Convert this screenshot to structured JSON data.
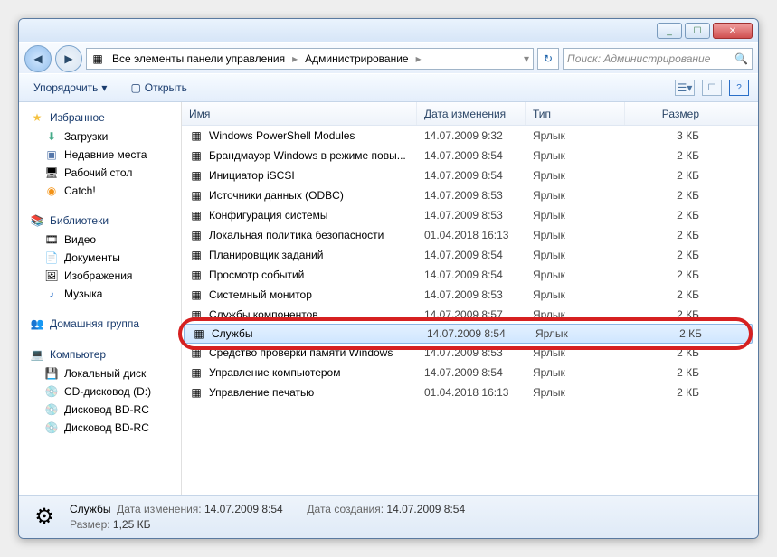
{
  "titlebar": {
    "min": "_",
    "max": "☐",
    "close": "✕"
  },
  "nav": {
    "crumb1": "Все элементы панели управления",
    "crumb2": "Администрирование",
    "search_placeholder": "Поиск: Администрирование"
  },
  "toolbar": {
    "organize": "Упорядочить",
    "open": "Открыть"
  },
  "sidebar": {
    "favorites": "Избранное",
    "fav_items": [
      "Загрузки",
      "Недавние места",
      "Рабочий стол",
      "Catch!"
    ],
    "libs": "Библиотеки",
    "lib_items": [
      "Видео",
      "Документы",
      "Изображения",
      "Музыка"
    ],
    "homegroup": "Домашняя группа",
    "computer": "Компьютер",
    "comp_items": [
      "Локальный диск",
      "CD-дисковод (D:)",
      "Дисковод BD-RС",
      "Дисковод BD-RС"
    ]
  },
  "columns": {
    "name": "Имя",
    "date": "Дата изменения",
    "type": "Тип",
    "size": "Размер"
  },
  "rows": [
    {
      "name": "Windows PowerShell Modules",
      "date": "14.07.2009 9:32",
      "type": "Ярлык",
      "size": "3 КБ"
    },
    {
      "name": "Брандмауэр Windows в режиме повы...",
      "date": "14.07.2009 8:54",
      "type": "Ярлык",
      "size": "2 КБ"
    },
    {
      "name": "Инициатор iSCSI",
      "date": "14.07.2009 8:54",
      "type": "Ярлык",
      "size": "2 КБ"
    },
    {
      "name": "Источники данных (ODBC)",
      "date": "14.07.2009 8:53",
      "type": "Ярлык",
      "size": "2 КБ"
    },
    {
      "name": "Конфигурация системы",
      "date": "14.07.2009 8:53",
      "type": "Ярлык",
      "size": "2 КБ"
    },
    {
      "name": "Локальная политика безопасности",
      "date": "01.04.2018 16:13",
      "type": "Ярлык",
      "size": "2 КБ"
    },
    {
      "name": "Планировщик заданий",
      "date": "14.07.2009 8:54",
      "type": "Ярлык",
      "size": "2 КБ"
    },
    {
      "name": "Просмотр событий",
      "date": "14.07.2009 8:54",
      "type": "Ярлык",
      "size": "2 КБ"
    },
    {
      "name": "Системный монитор",
      "date": "14.07.2009 8:53",
      "type": "Ярлык",
      "size": "2 КБ"
    },
    {
      "name": "Службы компонентов",
      "date": "14.07.2009 8:57",
      "type": "Ярлык",
      "size": "2 КБ"
    },
    {
      "name": "Службы",
      "date": "14.07.2009 8:54",
      "type": "Ярлык",
      "size": "2 КБ",
      "selected": true,
      "highlight": true
    },
    {
      "name": "Средство проверки памяти Windows",
      "date": "14.07.2009 8:53",
      "type": "Ярлык",
      "size": "2 КБ"
    },
    {
      "name": "Управление компьютером",
      "date": "14.07.2009 8:54",
      "type": "Ярлык",
      "size": "2 КБ"
    },
    {
      "name": "Управление печатью",
      "date": "01.04.2018 16:13",
      "type": "Ярлык",
      "size": "2 КБ"
    }
  ],
  "status": {
    "title": "Службы",
    "l_date": "Дата изменения:",
    "v_date": "14.07.2009 8:54",
    "l_size": "Размер:",
    "v_size": "1,25 КБ",
    "l_created": "Дата создания:",
    "v_created": "14.07.2009 8:54"
  },
  "icons": {
    "star": "★",
    "download": "⬇",
    "recent": "▣",
    "desktop": "🖥",
    "catch": "◉",
    "libs": "📚",
    "video": "🎞",
    "docs": "📄",
    "images": "🖼",
    "music": "♪",
    "home": "👥",
    "computer": "💻",
    "drive": "💾",
    "cd": "💿",
    "bd": "💿",
    "shortcut": "▦",
    "gear": "⚙",
    "back": "◀",
    "fwd": "▶",
    "dd": "▾",
    "refresh": "↻",
    "search": "🔍",
    "open": "▢",
    "views": "☰",
    "help": "?"
  }
}
